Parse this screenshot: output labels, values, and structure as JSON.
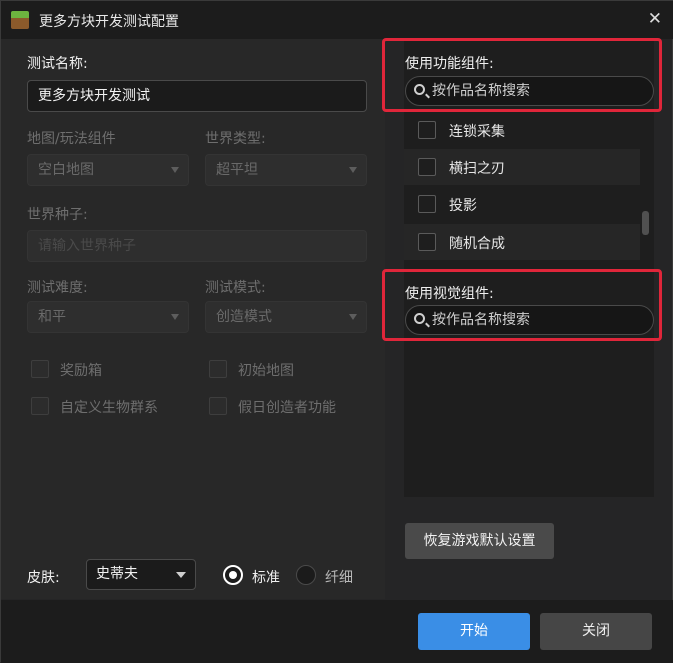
{
  "window": {
    "title": "更多方块开发测试配置",
    "close_glyph": "✕"
  },
  "test_name": {
    "label": "测试名称:",
    "value": "更多方块开发测试"
  },
  "map_component": {
    "label": "地图/玩法组件",
    "value": "空白地图"
  },
  "world_type": {
    "label": "世界类型:",
    "value": "超平坦"
  },
  "world_seed": {
    "label": "世界种子:",
    "placeholder": "请输入世界种子"
  },
  "difficulty": {
    "label": "测试难度:",
    "value": "和平"
  },
  "test_mode": {
    "label": "测试模式:",
    "value": "创造模式"
  },
  "options": {
    "bonus_chest": "奖励箱",
    "initial_map": "初始地图",
    "custom_biome": "自定义生物群系",
    "holiday_creator": "假日创造者功能"
  },
  "function_components": {
    "title": "使用功能组件:",
    "search_placeholder": "按作品名称搜索",
    "items": [
      "连锁采集",
      "横扫之刃",
      "投影",
      "随机合成"
    ]
  },
  "visual_components": {
    "title": "使用视觉组件:",
    "search_placeholder": "按作品名称搜索"
  },
  "restore_button": "恢复游戏默认设置",
  "skin": {
    "label": "皮肤:",
    "value": "史蒂夫",
    "model_standard": "标准",
    "model_slim": "纤细",
    "selected": "标准"
  },
  "footer": {
    "start": "开始",
    "close": "关闭"
  },
  "colors": {
    "accent": "#3a8ee6",
    "highlight": "#e0263a"
  }
}
